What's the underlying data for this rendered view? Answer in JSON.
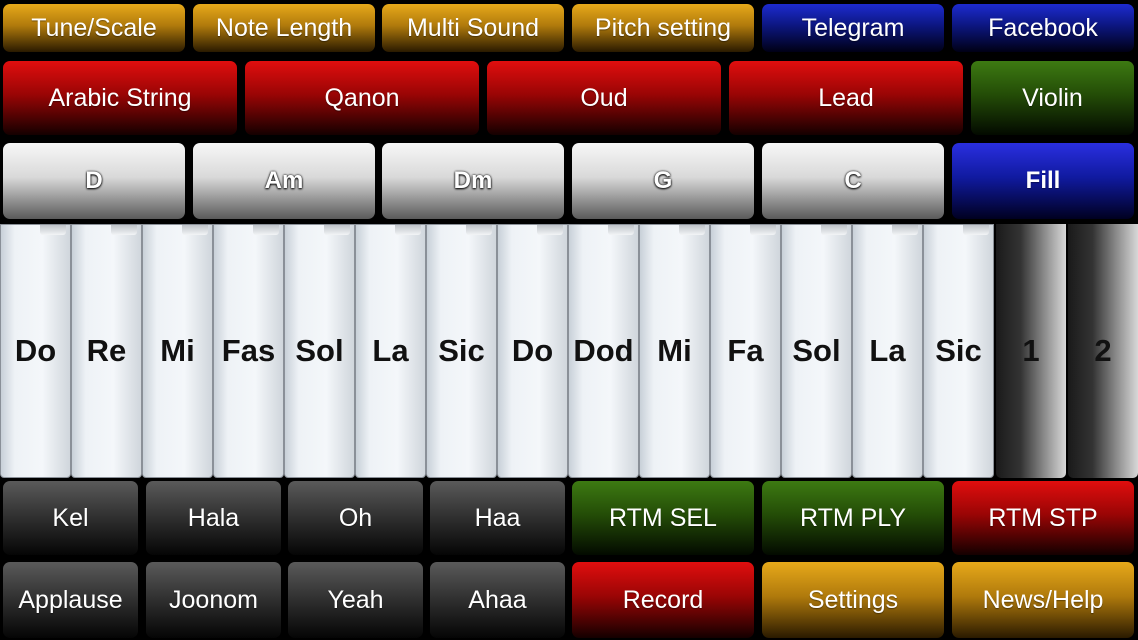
{
  "top_menu": [
    "Tune/Scale",
    "Note Length",
    "Multi Sound",
    "Pitch setting",
    "Telegram",
    "Facebook"
  ],
  "instruments": [
    "Arabic String",
    "Qanon",
    "Oud",
    "Lead",
    "Violin"
  ],
  "chords": [
    "D",
    "Am",
    "Dm",
    "G",
    "C"
  ],
  "fill_label": "Fill",
  "keys": [
    "Do",
    "Re",
    "Mi",
    "Fas",
    "Sol",
    "La",
    "Sic",
    "Do",
    "Dod",
    "Mi",
    "Fa",
    "Sol",
    "La",
    "Sic"
  ],
  "drum_keys": [
    "1",
    "2"
  ],
  "voices_row1": [
    "Kel",
    "Hala",
    "Oh",
    "Haa"
  ],
  "rhythm": [
    "RTM SEL",
    "RTM PLY",
    "RTM STP"
  ],
  "voices_row2": [
    "Applause",
    "Joonom",
    "Yeah",
    "Ahaa"
  ],
  "bottom_actions": [
    "Record",
    "Settings",
    "News/Help"
  ],
  "colors": {
    "yellow": "#e7a91a",
    "blue": "#1d2bd0",
    "red": "#e10e0e",
    "green": "#3d7a12",
    "gray": "#5a5a5a"
  }
}
